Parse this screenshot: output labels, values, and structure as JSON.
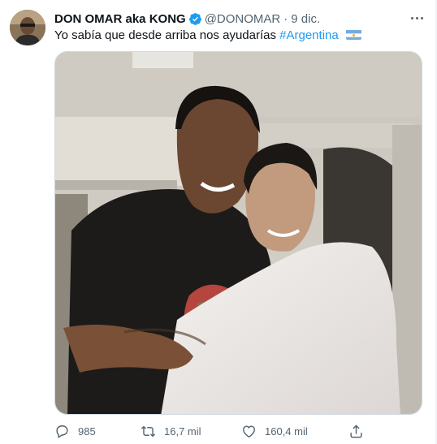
{
  "tweet": {
    "author_name": "DON OMAR aka KONG",
    "handle": "@DONOMAR",
    "separator": "·",
    "date": "9 dic.",
    "text": "Yo sabía que desde arriba nos ayudarías",
    "hashtag": "#Argentina",
    "flag_icon": "argentina-flag-icon"
  },
  "actions": {
    "replies": "985",
    "retweets": "16,7 mil",
    "likes": "160,4 mil"
  },
  "colors": {
    "text": "#0f1419",
    "secondary": "#536471",
    "link": "#1d9bf0",
    "verified": "#1d9bf0",
    "border": "#cfd9de"
  }
}
